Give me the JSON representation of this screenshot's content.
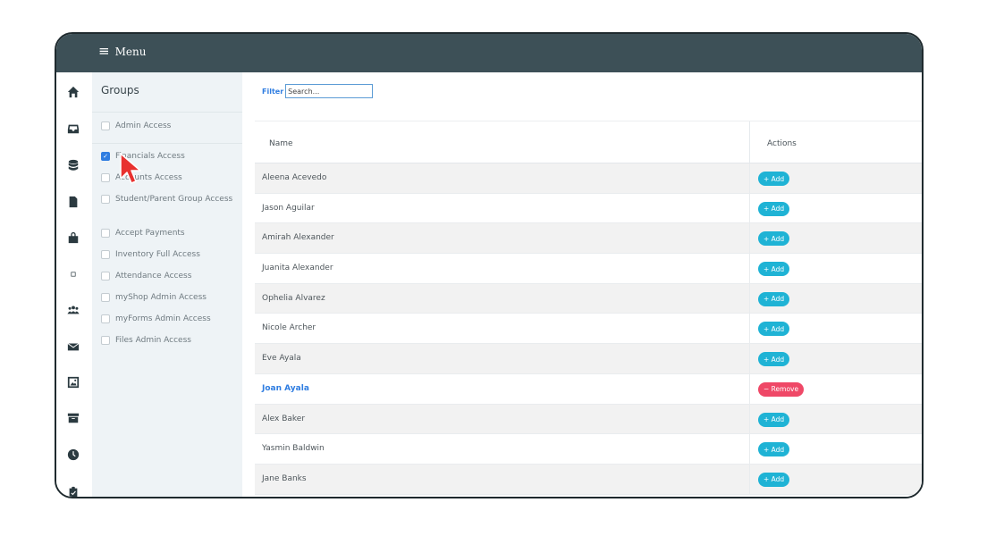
{
  "topbar": {
    "menu_icon": "≡",
    "menu_label": "Menu"
  },
  "leftnav": {
    "icons": [
      "home-icon",
      "inbox-icon",
      "database-icon",
      "file-icon",
      "shopping-bag-icon",
      "square-icon",
      "users-icon",
      "envelope-icon",
      "image-icon",
      "archive-icon",
      "clock-icon",
      "badge-icon"
    ]
  },
  "groups": {
    "title": "Groups",
    "items": [
      {
        "label": "Admin Access",
        "checked": false
      },
      {
        "label": "Financials Access",
        "checked": true
      },
      {
        "label": "Accounts Access",
        "checked": false
      },
      {
        "label": "Student/Parent Group Access",
        "checked": false
      },
      {
        "label": "Accept Payments",
        "checked": false
      },
      {
        "label": "Inventory Full Access",
        "checked": false
      },
      {
        "label": "Attendance Access",
        "checked": false
      },
      {
        "label": "myShop Admin Access",
        "checked": false
      },
      {
        "label": "myForms Admin Access",
        "checked": false
      },
      {
        "label": "Files Admin Access",
        "checked": false
      }
    ]
  },
  "filter": {
    "label": "Filter",
    "placeholder": "Search..."
  },
  "table": {
    "headers": {
      "name": "Name",
      "actions": "Actions"
    },
    "rows": [
      {
        "name": "Aleena Acevedo",
        "action": "+ Add",
        "active": false
      },
      {
        "name": "Jason Aguilar",
        "action": "+ Add",
        "active": false
      },
      {
        "name": "Amirah Alexander",
        "action": "+ Add",
        "active": false
      },
      {
        "name": "Juanita Alexander",
        "action": "+ Add",
        "active": false
      },
      {
        "name": "Ophelia Alvarez",
        "action": "+ Add",
        "active": false
      },
      {
        "name": "Nicole Archer",
        "action": "+ Add",
        "active": false
      },
      {
        "name": "Eve Ayala",
        "action": "+ Add",
        "active": false
      },
      {
        "name": "Joan Ayala",
        "action": "− Remove",
        "active": true
      },
      {
        "name": "Alex Baker",
        "action": "+ Add",
        "active": false
      },
      {
        "name": "Yasmin Baldwin",
        "action": "+ Add",
        "active": false
      },
      {
        "name": "Jane Banks",
        "action": "+ Add",
        "active": false
      }
    ]
  },
  "colors": {
    "topbar": "#3d5057",
    "accent": "#2f7de1",
    "add": "#1fb3d5",
    "remove": "#ef4867",
    "cursor": "#e8312f"
  }
}
